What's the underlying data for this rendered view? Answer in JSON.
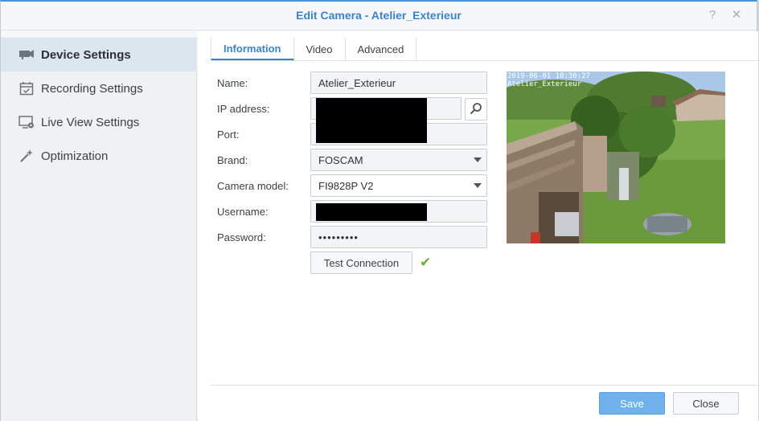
{
  "window": {
    "title": "Edit Camera - Atelier_Exterieur",
    "help_icon": "help-icon",
    "close_icon": "close-icon",
    "accent_color": "#3b83c8"
  },
  "sidebar": {
    "items": [
      {
        "label": "Device Settings",
        "icon": "camera-icon",
        "active": true
      },
      {
        "label": "Recording Settings",
        "icon": "calendar-check-icon",
        "active": false
      },
      {
        "label": "Live View Settings",
        "icon": "monitor-settings-icon",
        "active": false
      },
      {
        "label": "Optimization",
        "icon": "magic-wand-icon",
        "active": false
      }
    ]
  },
  "tabs": [
    {
      "label": "Information",
      "active": true
    },
    {
      "label": "Video",
      "active": false
    },
    {
      "label": "Advanced",
      "active": false
    }
  ],
  "form": {
    "name_label": "Name:",
    "name_value": "Atelier_Exterieur",
    "ip_label": "IP address:",
    "ip_value": "[redacted]",
    "port_label": "Port:",
    "port_value": "[redacted]",
    "brand_label": "Brand:",
    "brand_value": "FOSCAM",
    "model_label": "Camera model:",
    "model_value": "FI9828P V2",
    "username_label": "Username:",
    "username_value": "[redacted]",
    "password_label": "Password:",
    "password_value": "•••••••••",
    "test_button": "Test Connection",
    "test_status_icon": "checkmark-icon"
  },
  "preview": {
    "timestamp": "2019-06-01 10:30:27",
    "camera_label": "Atelier_Exterieur"
  },
  "footer": {
    "save_label": "Save",
    "close_label": "Close"
  }
}
